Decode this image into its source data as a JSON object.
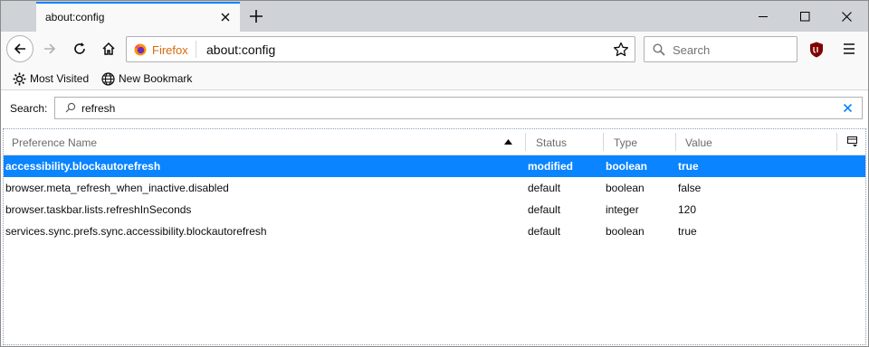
{
  "tab": {
    "title": "about:config"
  },
  "navbar": {
    "identity_label": "Firefox",
    "url": "about:config",
    "search_placeholder": "Search"
  },
  "bookmarks": [
    {
      "label": "Most Visited",
      "icon": "gear-icon"
    },
    {
      "label": "New Bookmark",
      "icon": "globe-icon"
    }
  ],
  "config": {
    "search_label": "Search:",
    "filter_value": "refresh",
    "columns": {
      "name": "Preference Name",
      "status": "Status",
      "type": "Type",
      "value": "Value"
    },
    "rows": [
      {
        "name": "accessibility.blockautorefresh",
        "status": "modified",
        "type": "boolean",
        "value": "true",
        "selected": true
      },
      {
        "name": "browser.meta_refresh_when_inactive.disabled",
        "status": "default",
        "type": "boolean",
        "value": "false"
      },
      {
        "name": "browser.taskbar.lists.refreshInSeconds",
        "status": "default",
        "type": "integer",
        "value": "120"
      },
      {
        "name": "services.sync.prefs.sync.accessibility.blockautorefresh",
        "status": "default",
        "type": "boolean",
        "value": "true"
      }
    ]
  },
  "colors": {
    "accent": "#0a84ff",
    "identity": "#d7690c",
    "tabstrip": "#cfd2d6"
  }
}
